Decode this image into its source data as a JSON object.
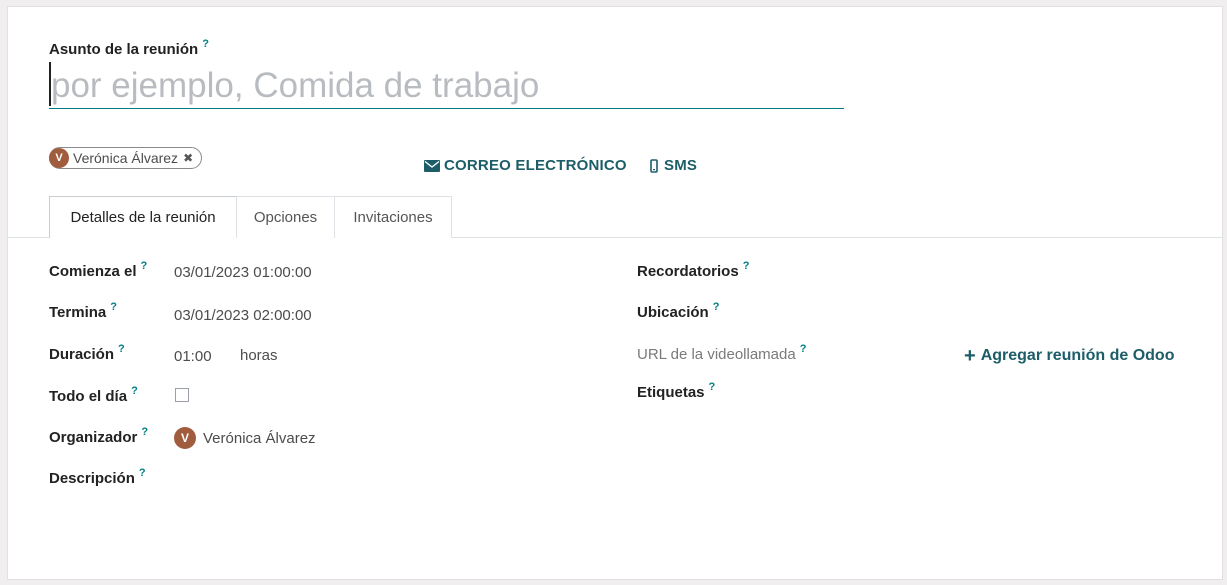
{
  "subject": {
    "label": "Asunto de la reunión",
    "help": "?",
    "placeholder": "por ejemplo, Comida de trabajo",
    "value": ""
  },
  "attendee_tag": {
    "initial": "V",
    "name": "Verónica Álvarez",
    "remove": "✖"
  },
  "actions": {
    "email": "CORREO ELECTRÓNICO",
    "sms": "SMS"
  },
  "tabs": [
    {
      "label": "Detalles de la reunión",
      "active": true
    },
    {
      "label": "Opciones",
      "active": false
    },
    {
      "label": "Invitaciones",
      "active": false
    }
  ],
  "left_fields": {
    "start": {
      "label": "Comienza el",
      "help": "?",
      "value": "03/01/2023 01:00:00"
    },
    "stop": {
      "label": "Termina",
      "help": "?",
      "value": "03/01/2023 02:00:00"
    },
    "duration": {
      "label": "Duración",
      "help": "?",
      "value": "01:00",
      "unit": "horas"
    },
    "allday": {
      "label": "Todo el día",
      "help": "?",
      "checked": false
    },
    "organizer": {
      "label": "Organizador",
      "help": "?",
      "initial": "V",
      "value": "Verónica Álvarez"
    },
    "description": {
      "label": "Descripción",
      "help": "?"
    }
  },
  "right_fields": {
    "reminders": {
      "label": "Recordatorios",
      "help": "?"
    },
    "location": {
      "label": "Ubicación",
      "help": "?"
    },
    "video_url": {
      "label": "URL de la videollamada",
      "help": "?"
    },
    "add_meeting": {
      "icon": "+",
      "label": "Agregar reunión de Odoo"
    },
    "tags": {
      "label": "Etiquetas",
      "help": "?"
    }
  },
  "colors": {
    "accent": "#017e84",
    "action_text": "#1d5d68",
    "avatar": "#a15c3e"
  }
}
